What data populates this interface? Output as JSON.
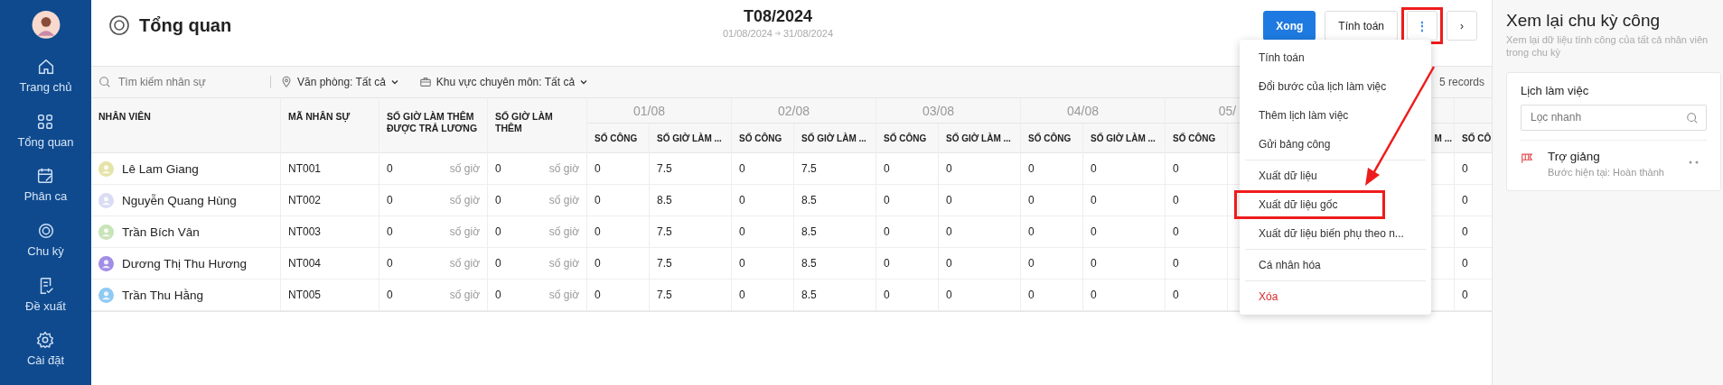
{
  "sidebar": {
    "items": [
      {
        "label": "Trang chủ"
      },
      {
        "label": "Tổng quan"
      },
      {
        "label": "Phân ca"
      },
      {
        "label": "Chu kỳ"
      },
      {
        "label": "Đề xuất"
      },
      {
        "label": "Cài đặt"
      }
    ]
  },
  "header": {
    "title": "Tổng quan",
    "period": "T08/2024",
    "range_start": "01/08/2024",
    "range_end": "31/08/2024",
    "buttons": [
      {
        "label": "Xong",
        "kind": "primary",
        "annotated": false
      },
      {
        "label": "Tính toán",
        "kind": "default",
        "annotated": false
      },
      {
        "label": "⋮",
        "kind": "more",
        "annotated": true
      },
      {
        "label": "›",
        "kind": "next",
        "annotated": false
      }
    ]
  },
  "filters": {
    "search": {
      "placeholder": "Tìm kiếm nhân sự"
    },
    "office": "Văn phòng: Tất cả",
    "area": "Khu vực chuyên môn: Tất cả",
    "records": "5 records"
  },
  "table": {
    "columns": [
      "NHÂN VIÊN",
      "MÃ NHÂN SỰ",
      "SỐ GIỜ LÀM THÊM ĐƯỢC TRẢ LƯƠNG",
      "SỐ GIỜ LÀM THÊM"
    ],
    "rows": [
      {
        "name": "Lê Lam Giang",
        "color": "#e6e3a8",
        "code": "NT001",
        "paid_overtime": {
          "value": "0",
          "unit": "số giờ"
        },
        "overtime": {
          "value": "0",
          "unit": "số giờ"
        }
      },
      {
        "name": "Nguyễn Quang Hùng",
        "color": "#d9dcf2",
        "code": "NT002",
        "paid_overtime": {
          "value": "0",
          "unit": "số giờ"
        },
        "overtime": {
          "value": "0",
          "unit": "số giờ"
        }
      },
      {
        "name": "Trần Bích Vân",
        "color": "#c8e4b8",
        "code": "NT003",
        "paid_overtime": {
          "value": "0",
          "unit": "số giờ"
        },
        "overtime": {
          "value": "0",
          "unit": "số giờ"
        }
      },
      {
        "name": "Dương Thị Thu Hương",
        "color": "#a08de6",
        "code": "NT004",
        "paid_overtime": {
          "value": "0",
          "unit": "số giờ"
        },
        "overtime": {
          "value": "0",
          "unit": "số giờ"
        }
      },
      {
        "name": "Trần Thu Hằng",
        "color": "#8fcaf3",
        "code": "NT005",
        "paid_overtime": {
          "value": "0",
          "unit": "số giờ"
        },
        "overtime": {
          "value": "0",
          "unit": "số giờ"
        }
      }
    ],
    "day_groups": [
      {
        "date": "01/08",
        "columns": [
          {
            "kind": "count",
            "label": "SỐ CÔNG",
            "values": [
              "0",
              "0",
              "0",
              "0",
              "0"
            ]
          },
          {
            "kind": "hours",
            "label": "SỐ GIỜ LÀM ...",
            "values": [
              "7.5",
              "8.5",
              "7.5",
              "7.5",
              "7.5"
            ]
          }
        ]
      },
      {
        "date": "02/08",
        "columns": [
          {
            "kind": "count",
            "label": "SỐ CÔNG",
            "values": [
              "0",
              "0",
              "0",
              "0",
              "0"
            ]
          },
          {
            "kind": "hours",
            "label": "SỐ GIỜ LÀM ...",
            "values": [
              "7.5",
              "8.5",
              "8.5",
              "8.5",
              "8.5"
            ]
          }
        ]
      },
      {
        "date": "03/08",
        "columns": [
          {
            "kind": "count",
            "label": "SỐ CÔNG",
            "values": [
              "0",
              "0",
              "0",
              "0",
              "0"
            ]
          },
          {
            "kind": "hours",
            "label": "SỐ GIỜ LÀM ...",
            "values": [
              "0",
              "0",
              "0",
              "0",
              "0"
            ]
          }
        ]
      },
      {
        "date": "04/08",
        "columns": [
          {
            "kind": "count",
            "label": "SỐ CÔNG",
            "values": [
              "0",
              "0",
              "0",
              "0",
              "0"
            ]
          },
          {
            "kind": "hours",
            "label": "SỐ GIỜ LÀM ...",
            "values": [
              "0",
              "0",
              "0",
              "0",
              "0"
            ]
          }
        ]
      },
      {
        "date": "05/",
        "columns": [
          {
            "kind": "count",
            "label": "SỐ CÔNG",
            "values": [
              "0",
              "0",
              "0",
              "0",
              "0"
            ]
          }
        ]
      },
      {
        "columns": [
          {
            "kind": "hours",
            "label": "M ..."
          }
        ]
      },
      {
        "columns": [
          {
            "kind": "count",
            "label": "SỐ CÔ",
            "values": [
              "0",
              "0",
              "0",
              "0",
              "0"
            ]
          }
        ]
      }
    ]
  },
  "menu": {
    "groups": [
      [
        {
          "label": "Tính toán",
          "kind": "normal",
          "annotated": false
        },
        {
          "label": "Đổi bước của lịch làm việc",
          "kind": "normal",
          "annotated": false
        },
        {
          "label": "Thêm lịch làm việc",
          "kind": "normal",
          "annotated": false
        },
        {
          "label": "Gửi bảng công",
          "kind": "normal",
          "annotated": false
        }
      ],
      [
        {
          "label": "Xuất dữ liệu",
          "kind": "normal",
          "annotated": false
        },
        {
          "label": "Xuất dữ liệu gốc",
          "kind": "normal",
          "annotated": true
        },
        {
          "label": "Xuất dữ liệu biến phụ theo n...",
          "kind": "normal",
          "annotated": false
        }
      ],
      [
        {
          "label": "Cá nhân hóa",
          "kind": "normal",
          "annotated": false
        }
      ],
      [
        {
          "label": "Xóa",
          "kind": "danger",
          "annotated": false
        }
      ]
    ]
  },
  "panel": {
    "title": "Xem lại chu kỳ công",
    "subtitle": "Xem lại dữ liệu tính công của tất cả nhân viên trong chu kỳ",
    "card": {
      "title": "Lịch làm việc",
      "search": {
        "placeholder": "Lọc nhanh"
      },
      "items": [
        {
          "name": "Trợ giảng",
          "step": "Bước hiện tại: Hoàn thành"
        }
      ]
    }
  }
}
